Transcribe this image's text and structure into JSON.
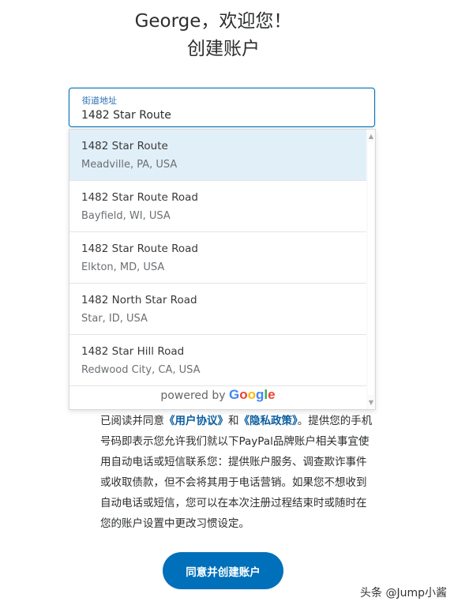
{
  "header": {
    "greeting": "George，欢迎您！",
    "subtitle": "创建账户"
  },
  "address_field": {
    "label": "街道地址",
    "value": "1482 Star Route"
  },
  "suggestions": [
    {
      "main": "1482 Star Route",
      "sub": "Meadville, PA, USA"
    },
    {
      "main": "1482 Star Route Road",
      "sub": "Bayfield, WI, USA"
    },
    {
      "main": "1482 Star Route Road",
      "sub": "Elkton, MD, USA"
    },
    {
      "main": "1482 North Star Road",
      "sub": "Star, ID, USA"
    },
    {
      "main": "1482 Star Hill Road",
      "sub": "Redwood City, CA, USA"
    }
  ],
  "powered_by": {
    "text": "powered by",
    "brand": "Google",
    "brand_colors": [
      "#4285F4",
      "#EA4335",
      "#FBBC05",
      "#4285F4",
      "#34A853",
      "#EA4335"
    ]
  },
  "legal": {
    "prefix": "已阅读并同意",
    "agreement_link": "《用户协议》",
    "and": "和",
    "privacy_link": "《隐私政策》",
    "body": "。提供您的手机号码即表示您允许我们就以下PayPal品牌账户相关事宜使用自动电话或短信联系您：提供账户服务、调查欺诈事件或收取债款，但不会将其用于电话营销。如果您不想收到自动电话或短信，您可以在本次注册过程结束时或随时在您的账户设置中更改习惯设定。"
  },
  "cta": {
    "label": "同意并创建账户"
  },
  "watermark": {
    "text": "头条 @Jump小酱"
  },
  "colors": {
    "accent": "#0070ba",
    "link": "#0a5e9e",
    "highlight_row": "#e1eff8"
  }
}
